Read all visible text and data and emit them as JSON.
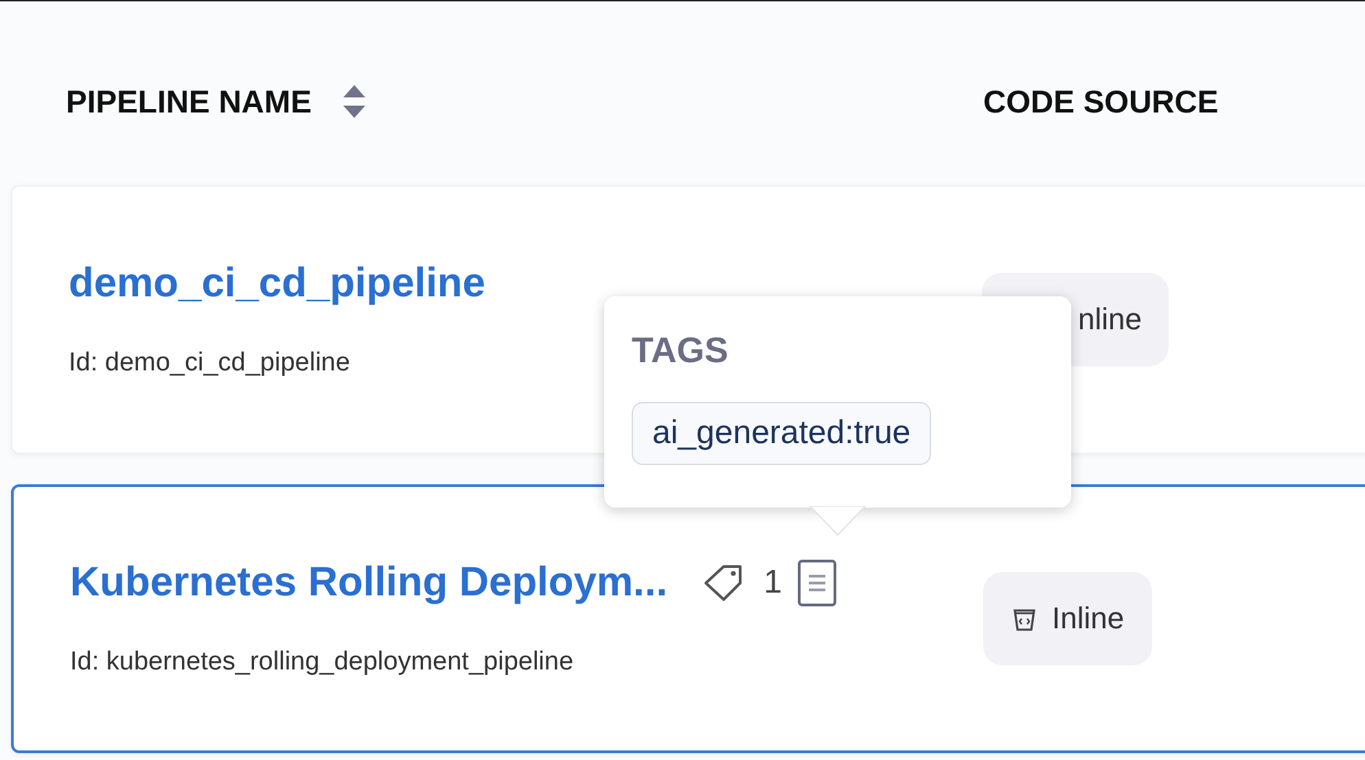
{
  "columns": [
    {
      "label": "PIPELINE NAME",
      "sortable": true
    },
    {
      "label": "CODE SOURCE",
      "sortable": false
    }
  ],
  "rows": [
    {
      "name": "demo_ci_cd_pipeline",
      "id": "Id: demo_ci_cd_pipeline",
      "selected": false,
      "code_source": "nline",
      "code_source_icon": false
    },
    {
      "name": "Kubernetes Rolling Deploym...",
      "id": "Id: kubernetes_rolling_deployment_pipeline",
      "selected": true,
      "tag_count": "1",
      "has_description": true,
      "code_source": "Inline",
      "code_source_icon": true
    }
  ],
  "tooltip": {
    "title": "TAGS",
    "tags": [
      "ai_generated:true"
    ]
  }
}
